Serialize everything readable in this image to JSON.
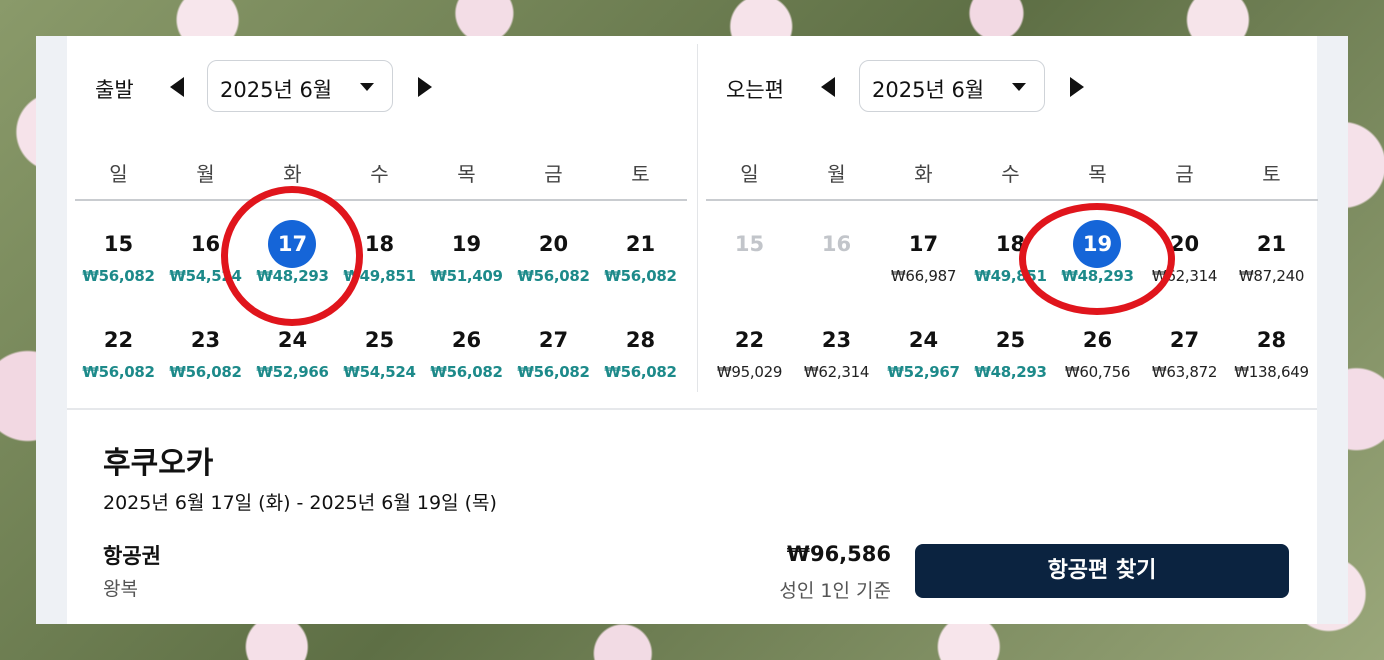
{
  "departure": {
    "title": "출발",
    "month": "2025년 6월",
    "weekdays": [
      "일",
      "월",
      "화",
      "수",
      "목",
      "금",
      "토"
    ],
    "week1": [
      {
        "day": "15",
        "price": "₩56,082"
      },
      {
        "day": "16",
        "price": "₩54,524"
      },
      {
        "day": "17",
        "price": "₩48,293"
      },
      {
        "day": "18",
        "price": "₩49,851"
      },
      {
        "day": "19",
        "price": "₩51,409"
      },
      {
        "day": "20",
        "price": "₩56,082"
      },
      {
        "day": "21",
        "price": "₩56,082"
      }
    ],
    "week2": [
      {
        "day": "22",
        "price": "₩56,082"
      },
      {
        "day": "23",
        "price": "₩56,082"
      },
      {
        "day": "24",
        "price": "₩52,966"
      },
      {
        "day": "25",
        "price": "₩54,524"
      },
      {
        "day": "26",
        "price": "₩56,082"
      },
      {
        "day": "27",
        "price": "₩56,082"
      },
      {
        "day": "28",
        "price": "₩56,082"
      }
    ],
    "selected_day": "17"
  },
  "return": {
    "title": "오는편",
    "month": "2025년 6월",
    "weekdays": [
      "일",
      "월",
      "화",
      "수",
      "목",
      "금",
      "토"
    ],
    "week1": [
      {
        "day": "15",
        "price": ""
      },
      {
        "day": "16",
        "price": ""
      },
      {
        "day": "17",
        "price": "₩66,987"
      },
      {
        "day": "18",
        "price": "₩49,851"
      },
      {
        "day": "19",
        "price": "₩48,293"
      },
      {
        "day": "20",
        "price": "₩62,314"
      },
      {
        "day": "21",
        "price": "₩87,240"
      }
    ],
    "week2": [
      {
        "day": "22",
        "price": "₩95,029"
      },
      {
        "day": "23",
        "price": "₩62,314"
      },
      {
        "day": "24",
        "price": "₩52,967"
      },
      {
        "day": "25",
        "price": "₩48,293"
      },
      {
        "day": "26",
        "price": "₩60,756"
      },
      {
        "day": "27",
        "price": "₩63,872"
      },
      {
        "day": "28",
        "price": "₩138,649"
      }
    ],
    "selected_day": "19"
  },
  "summary": {
    "destination": "후쿠오카",
    "dates": "2025년 6월 17일 (화) - 2025년 6월 19일 (목)",
    "product": "항공권",
    "trip_type": "왕복",
    "price": "₩96,586",
    "price_basis": "성인 1인 기준",
    "search_button": "항공편 찾기"
  },
  "colors": {
    "accent_price": "#1d8a8a",
    "selected_day": "#1565d8",
    "button_bg": "#0b2340",
    "annotation_ring": "#e0151c"
  }
}
